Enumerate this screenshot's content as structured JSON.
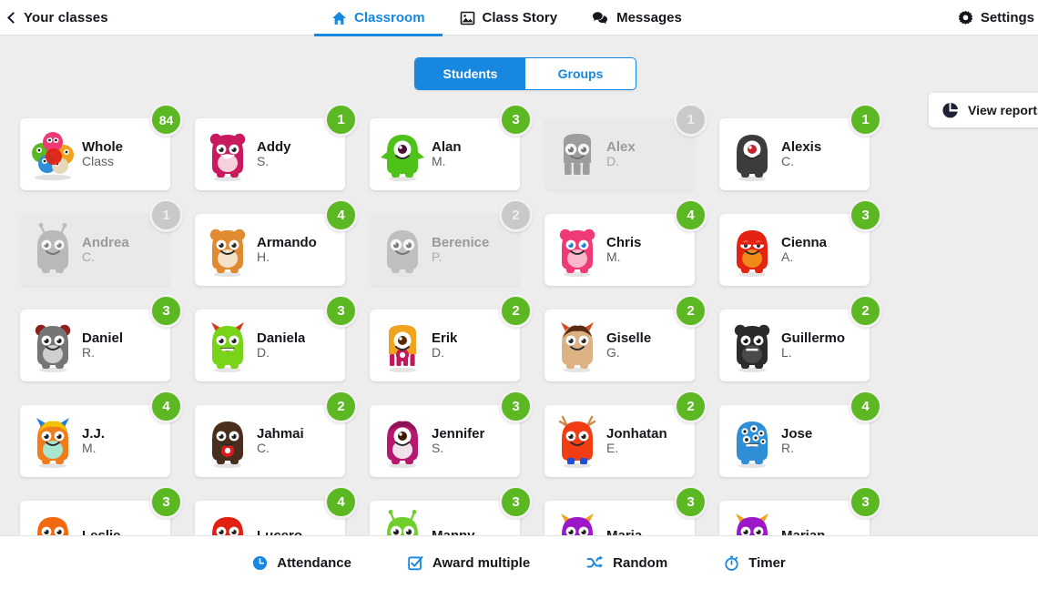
{
  "topnav": {
    "back_label": "Your classes",
    "back_icon": "chevron-left-icon",
    "tabs": [
      {
        "label": "Classroom",
        "icon": "home-icon",
        "active": true
      },
      {
        "label": "Class Story",
        "icon": "photo-icon",
        "active": false
      },
      {
        "label": "Messages",
        "icon": "chat-icon",
        "active": false
      }
    ],
    "settings_label": "Settings",
    "settings_icon": "gear-icon"
  },
  "subheader": {
    "segmented": {
      "students_label": "Students",
      "groups_label": "Groups",
      "selected": "Students"
    },
    "view_reports_label": "View reports",
    "view_reports_icon": "pie-chart-icon"
  },
  "colors": {
    "accent_blue": "#1787e0",
    "badge_green": "#5bb822",
    "badge_grey": "#c9c9c9",
    "page_bg": "#ededed",
    "card_bg": "#ffffff"
  },
  "grid": {
    "columns": 5,
    "rows": [
      [
        {
          "first": "Whole",
          "last": "Class",
          "points": "84",
          "active": true,
          "whole_class": true,
          "avatar": "whole-class-avatar"
        },
        {
          "first": "Addy",
          "last": "S.",
          "points": "1",
          "active": true,
          "avatar": "monster-pink"
        },
        {
          "first": "Alan",
          "last": "M.",
          "points": "3",
          "active": true,
          "avatar": "monster-green-cyclops"
        },
        {
          "first": "Alex",
          "last": "D.",
          "points": "1",
          "active": false,
          "avatar": "monster-grey-tall"
        },
        {
          "first": "Alexis",
          "last": "C.",
          "points": "1",
          "active": true,
          "avatar": "monster-dark-cyclops"
        }
      ],
      [
        {
          "first": "Andrea",
          "last": "C.",
          "points": "1",
          "active": false,
          "avatar": "monster-grey-antenna"
        },
        {
          "first": "Armando",
          "last": "H.",
          "points": "4",
          "active": true,
          "avatar": "monster-orange-tiger"
        },
        {
          "first": "Berenice",
          "last": "P.",
          "points": "2",
          "active": false,
          "avatar": "monster-grey-furry"
        },
        {
          "first": "Chris",
          "last": "M.",
          "points": "4",
          "active": true,
          "avatar": "monster-pink-bear"
        },
        {
          "first": "Cienna",
          "last": "A.",
          "points": "3",
          "active": true,
          "avatar": "monster-red-sleepy"
        }
      ],
      [
        {
          "first": "Daniel",
          "last": "R.",
          "points": "3",
          "active": true,
          "avatar": "monster-grey-bear"
        },
        {
          "first": "Daniela",
          "last": "D.",
          "points": "3",
          "active": true,
          "avatar": "monster-green-toothy"
        },
        {
          "first": "Erik",
          "last": "D.",
          "points": "2",
          "active": true,
          "avatar": "monster-orange-eye"
        },
        {
          "first": "Giselle",
          "last": "G.",
          "points": "2",
          "active": true,
          "avatar": "monster-tan-horns"
        },
        {
          "first": "Guillermo",
          "last": "L.",
          "points": "2",
          "active": true,
          "avatar": "monster-black-bear"
        }
      ],
      [
        {
          "first": "J.J.",
          "last": "M.",
          "points": "4",
          "active": true,
          "avatar": "monster-orange-horns"
        },
        {
          "first": "Jahmai",
          "last": "C.",
          "points": "2",
          "active": true,
          "avatar": "monster-brown-furry"
        },
        {
          "first": "Jennifer",
          "last": "S.",
          "points": "3",
          "active": true,
          "avatar": "monster-magenta-cyclops"
        },
        {
          "first": "Jonhatan",
          "last": "E.",
          "points": "2",
          "active": true,
          "avatar": "monster-red-antlers"
        },
        {
          "first": "Jose",
          "last": "R.",
          "points": "4",
          "active": true,
          "avatar": "monster-blue-many-eyes"
        }
      ],
      [
        {
          "first": "Leslie",
          "last": "",
          "points": "3",
          "active": true,
          "avatar": "monster-orange-small"
        },
        {
          "first": "Lucero",
          "last": "",
          "points": "4",
          "active": true,
          "avatar": "monster-red-small"
        },
        {
          "first": "Manny",
          "last": "",
          "points": "3",
          "active": true,
          "avatar": "monster-green-alien"
        },
        {
          "first": "Maria",
          "last": "",
          "points": "3",
          "active": true,
          "avatar": "monster-purple-horns"
        },
        {
          "first": "Marian",
          "last": "",
          "points": "3",
          "active": true,
          "avatar": "monster-purple-horns"
        }
      ]
    ]
  },
  "bottombar": {
    "items": [
      {
        "label": "Attendance",
        "icon": "clock-icon"
      },
      {
        "label": "Award multiple",
        "icon": "checkbox-icon"
      },
      {
        "label": "Random",
        "icon": "shuffle-icon"
      },
      {
        "label": "Timer",
        "icon": "timer-icon"
      }
    ]
  }
}
